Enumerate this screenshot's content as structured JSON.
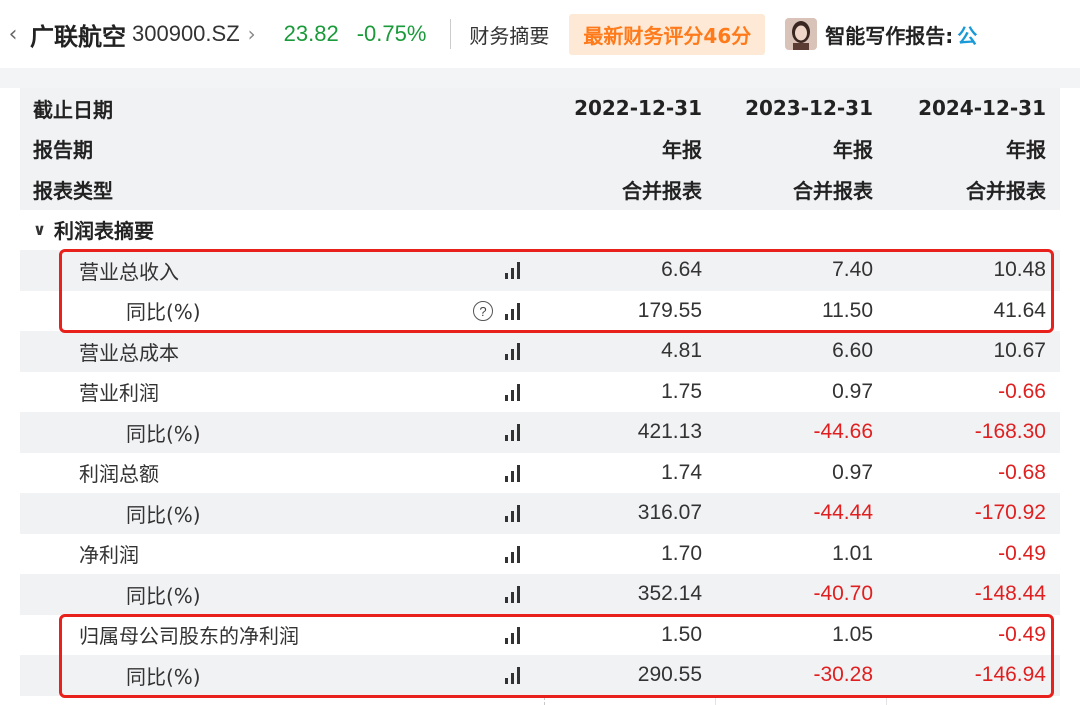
{
  "header": {
    "stock_name": "广联航空",
    "stock_code": "300900.SZ",
    "price": "23.82",
    "change_pct": "-0.75%",
    "fin_summary_link": "财务摘要",
    "score_badge": "最新财务评分46分",
    "report_link": "智能写作报告:",
    "report_extra": "公",
    "colors": {
      "down": "#1a9a3a",
      "badge_text": "#ff7a1a",
      "badge_bg": "#fde9d6",
      "negative": "#e02020",
      "highlight": "#e8211c"
    }
  },
  "table": {
    "header_rows": [
      {
        "label": "截止日期",
        "values": [
          "2022-12-31",
          "2023-12-31",
          "2024-12-31"
        ]
      },
      {
        "label": "报告期",
        "values": [
          "年报",
          "年报",
          "年报"
        ]
      },
      {
        "label": "报表类型",
        "values": [
          "合并报表",
          "合并报表",
          "合并报表"
        ]
      }
    ],
    "section": {
      "label": "利润表摘要",
      "icon": "chevron-down-icon"
    },
    "rows": [
      {
        "label": "营业总收入",
        "values": [
          "6.64",
          "7.40",
          "10.48"
        ]
      },
      {
        "label": "同比(%)",
        "values": [
          "179.55",
          "11.50",
          "41.64"
        ],
        "help": "?"
      },
      {
        "label": "营业总成本",
        "values": [
          "4.81",
          "6.60",
          "10.67"
        ]
      },
      {
        "label": "营业利润",
        "values": [
          "1.75",
          "0.97",
          "-0.66"
        ]
      },
      {
        "label": "同比(%)",
        "values": [
          "421.13",
          "-44.66",
          "-168.30"
        ]
      },
      {
        "label": "利润总额",
        "values": [
          "1.74",
          "0.97",
          "-0.68"
        ]
      },
      {
        "label": "同比(%)",
        "values": [
          "316.07",
          "-44.44",
          "-170.92"
        ]
      },
      {
        "label": "净利润",
        "values": [
          "1.70",
          "1.01",
          "-0.49"
        ]
      },
      {
        "label": "同比(%)",
        "values": [
          "352.14",
          "-40.70",
          "-148.44"
        ]
      },
      {
        "label": "归属母公司股东的净利润",
        "values": [
          "1.50",
          "1.05",
          "-0.49"
        ]
      },
      {
        "label": "同比(%)",
        "values": [
          "290.55",
          "-30.28",
          "-146.94"
        ]
      }
    ]
  }
}
